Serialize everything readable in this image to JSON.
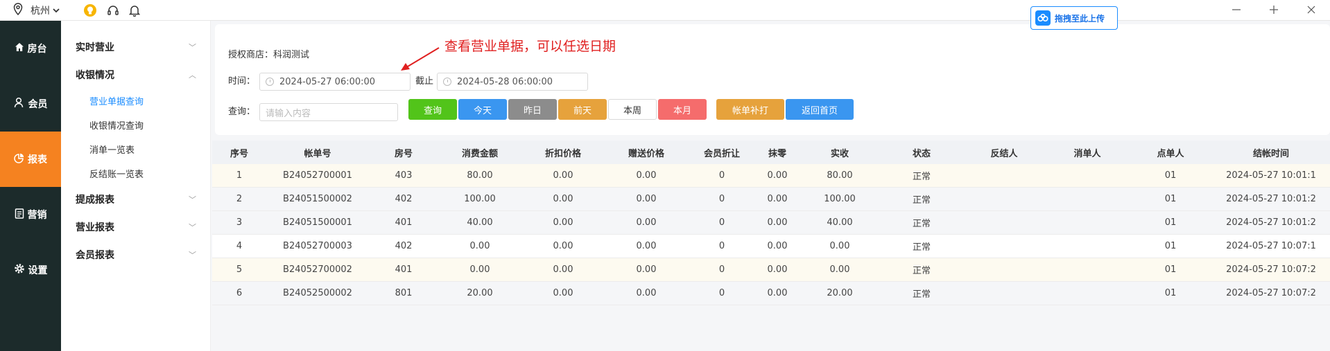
{
  "titlebar": {
    "city": "杭州",
    "upload_label": "拖拽至此上传"
  },
  "rail": [
    {
      "label": "房台",
      "icon": "home-icon"
    },
    {
      "label": "会员",
      "icon": "user-icon"
    },
    {
      "label": "报表",
      "icon": "pie-chart-icon",
      "active": true
    },
    {
      "label": "营销",
      "icon": "clipboard-icon"
    },
    {
      "label": "设置",
      "icon": "gear-icon"
    }
  ],
  "submenu": {
    "g1": "实时营业",
    "g2": "收银情况",
    "items": [
      "营业单据查询",
      "收银情况查询",
      "消单一览表",
      "反结账一览表"
    ],
    "g3": "提成报表",
    "g4": "营业报表",
    "g5": "会员报表"
  },
  "filter": {
    "store_label": "授权商店：科润测试",
    "time_label": "时间：",
    "start": "2024-05-27 06:00:00",
    "to_label": "截止",
    "end": "2024-05-28 06:00:00",
    "query_label": "查询：",
    "query_placeholder": "请输入内容",
    "buttons": [
      "查询",
      "今天",
      "昨日",
      "前天",
      "本周",
      "本月",
      "帐单补打",
      "返回首页"
    ],
    "annotation": "查看营业单据，可以任选日期"
  },
  "colors": {
    "query": "#52c41a",
    "today": "#3a96f0",
    "yesterday": "#8c8c8c",
    "daybefore": "#e6a23c",
    "week": "#ffffff",
    "month": "#f56c6c",
    "reprint": "#e6a23c",
    "home": "#3a96f0",
    "active_rail": "#f58220"
  },
  "table": {
    "headers": [
      "序号",
      "帐单号",
      "房号",
      "消费金额",
      "折扣价格",
      "赠送价格",
      "会员折让",
      "抹零",
      "实收",
      "状态",
      "反结人",
      "消单人",
      "点单人",
      "结帐时间"
    ],
    "rows": [
      [
        "1",
        "B24052700001",
        "403",
        "80.00",
        "0.00",
        "0.00",
        "0",
        "0.00",
        "80.00",
        "正常",
        "",
        "",
        "01",
        "2024-05-27 10:01:1"
      ],
      [
        "2",
        "B24051500002",
        "402",
        "100.00",
        "0.00",
        "0.00",
        "0",
        "0.00",
        "100.00",
        "正常",
        "",
        "",
        "01",
        "2024-05-27 10:01:2"
      ],
      [
        "3",
        "B24051500001",
        "401",
        "40.00",
        "0.00",
        "0.00",
        "0",
        "0.00",
        "40.00",
        "正常",
        "",
        "",
        "01",
        "2024-05-27 10:01:2"
      ],
      [
        "4",
        "B24052700003",
        "402",
        "0.00",
        "0.00",
        "0.00",
        "0",
        "0.00",
        "0.00",
        "正常",
        "",
        "",
        "01",
        "2024-05-27 10:07:1"
      ],
      [
        "5",
        "B24052700002",
        "401",
        "0.00",
        "0.00",
        "0.00",
        "0",
        "0.00",
        "0.00",
        "正常",
        "",
        "",
        "01",
        "2024-05-27 10:07:2"
      ],
      [
        "6",
        "B24052500002",
        "801",
        "20.00",
        "0.00",
        "0.00",
        "0",
        "0.00",
        "20.00",
        "正常",
        "",
        "",
        "01",
        "2024-05-27 10:07:2"
      ]
    ]
  }
}
